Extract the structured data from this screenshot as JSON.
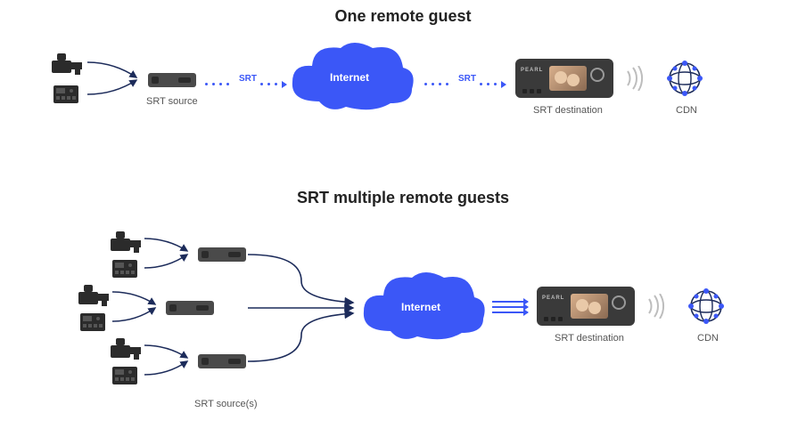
{
  "titles": {
    "single": "One remote guest",
    "multi": "SRT multiple remote guests"
  },
  "captions": {
    "srt_source": "SRT source",
    "srt_sources": "SRT source(s)",
    "srt_destination": "SRT destination",
    "cdn": "CDN"
  },
  "labels": {
    "srt": "SRT",
    "internet": "Internet"
  },
  "colors": {
    "brand_blue": "#3b57f7",
    "device_gray": "#3a3a3a",
    "flow_navy": "#1c2b5a"
  }
}
